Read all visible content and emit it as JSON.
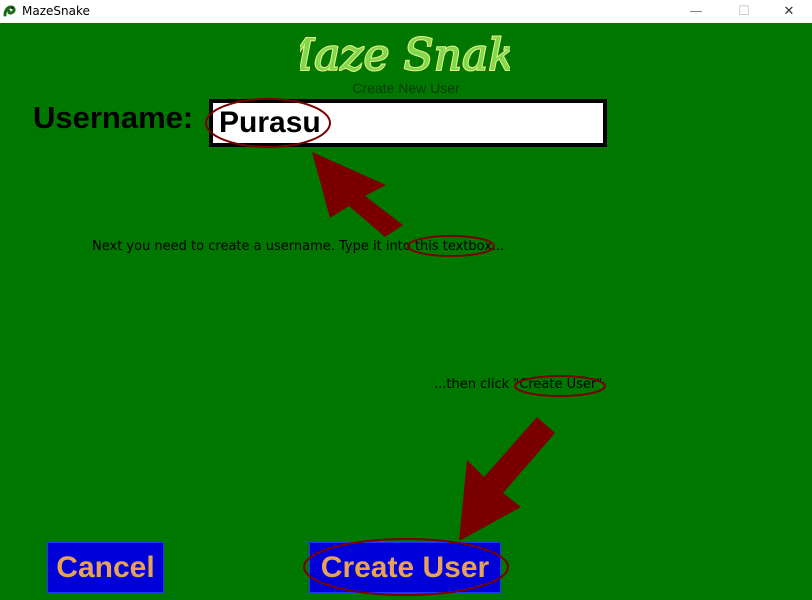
{
  "window": {
    "title": "MazeSnake",
    "app_icon": "snake-icon",
    "controls": {
      "minimize": "—",
      "maximize": "☐",
      "close": "✕"
    }
  },
  "logo": {
    "text": "Maze Snake"
  },
  "screen": {
    "subtitle": "Create New User"
  },
  "form": {
    "username_label": "Username:",
    "username_value": "Purasu"
  },
  "tutorial": {
    "step1_before": "Next you need to create a username. Type it into ",
    "step1_highlight": "this textbox",
    "step1_after": "...",
    "step2_before": "...then click ",
    "step2_highlight": "\"Create User\""
  },
  "buttons": {
    "cancel": "Cancel",
    "create_user": "Create User"
  },
  "colors": {
    "background": "#007800",
    "button_bg": "#0000d8",
    "button_text": "#e8a256",
    "annotation": "#7a0000",
    "logo_fill": "#7fd94a",
    "logo_outline": "#f0f08a"
  }
}
